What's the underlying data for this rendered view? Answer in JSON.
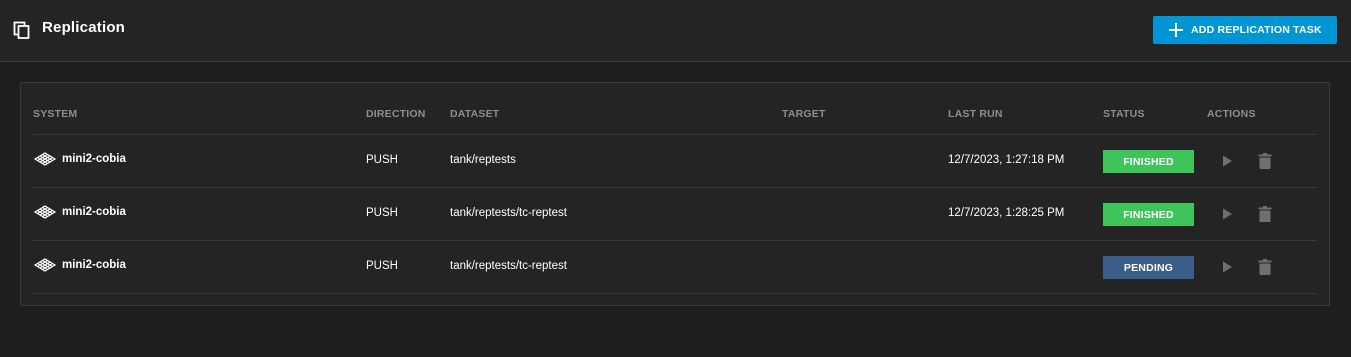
{
  "header": {
    "title": "Replication",
    "add_button_label": "ADD REPLICATION TASK"
  },
  "table": {
    "columns": {
      "system": "SYSTEM",
      "direction": "DIRECTION",
      "dataset": "DATASET",
      "target": "TARGET",
      "last_run": "LAST RUN",
      "status": "STATUS",
      "actions": "ACTIONS"
    },
    "rows": [
      {
        "system": "mini2-cobia",
        "direction": "PUSH",
        "dataset": "tank/reptests",
        "target": "",
        "last_run": "12/7/2023, 1:27:18 PM",
        "status": "FINISHED",
        "status_color": "#3fc45c"
      },
      {
        "system": "mini2-cobia",
        "direction": "PUSH",
        "dataset": "tank/reptests/tc-reptest",
        "target": "",
        "last_run": "12/7/2023, 1:28:25 PM",
        "status": "FINISHED",
        "status_color": "#3fc45c"
      },
      {
        "system": "mini2-cobia",
        "direction": "PUSH",
        "dataset": "tank/reptests/tc-reptest",
        "target": "",
        "last_run": "",
        "status": "PENDING",
        "status_color": "#3b5d8a"
      }
    ]
  },
  "icons": {
    "header": "copy-icon",
    "add": "plus-icon",
    "system": "truenas-mini-icon",
    "run": "play-icon",
    "delete": "trash-icon"
  },
  "colors": {
    "accent": "#0095d5",
    "finished": "#3fc45c",
    "pending": "#3b5d8a"
  }
}
